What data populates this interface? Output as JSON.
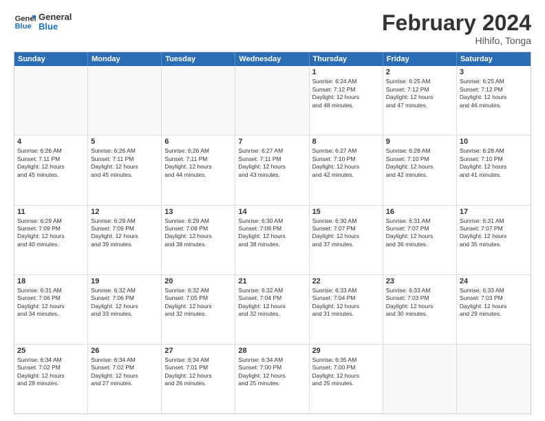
{
  "header": {
    "logo_line1": "General",
    "logo_line2": "Blue",
    "month": "February 2024",
    "location": "Hihifo, Tonga"
  },
  "days_of_week": [
    "Sunday",
    "Monday",
    "Tuesday",
    "Wednesday",
    "Thursday",
    "Friday",
    "Saturday"
  ],
  "weeks": [
    [
      {
        "day": "",
        "info": ""
      },
      {
        "day": "",
        "info": ""
      },
      {
        "day": "",
        "info": ""
      },
      {
        "day": "",
        "info": ""
      },
      {
        "day": "1",
        "info": "Sunrise: 6:24 AM\nSunset: 7:12 PM\nDaylight: 12 hours\nand 48 minutes."
      },
      {
        "day": "2",
        "info": "Sunrise: 6:25 AM\nSunset: 7:12 PM\nDaylight: 12 hours\nand 47 minutes."
      },
      {
        "day": "3",
        "info": "Sunrise: 6:25 AM\nSunset: 7:12 PM\nDaylight: 12 hours\nand 46 minutes."
      }
    ],
    [
      {
        "day": "4",
        "info": "Sunrise: 6:26 AM\nSunset: 7:11 PM\nDaylight: 12 hours\nand 45 minutes."
      },
      {
        "day": "5",
        "info": "Sunrise: 6:26 AM\nSunset: 7:11 PM\nDaylight: 12 hours\nand 45 minutes."
      },
      {
        "day": "6",
        "info": "Sunrise: 6:26 AM\nSunset: 7:11 PM\nDaylight: 12 hours\nand 44 minutes."
      },
      {
        "day": "7",
        "info": "Sunrise: 6:27 AM\nSunset: 7:11 PM\nDaylight: 12 hours\nand 43 minutes."
      },
      {
        "day": "8",
        "info": "Sunrise: 6:27 AM\nSunset: 7:10 PM\nDaylight: 12 hours\nand 42 minutes."
      },
      {
        "day": "9",
        "info": "Sunrise: 6:28 AM\nSunset: 7:10 PM\nDaylight: 12 hours\nand 42 minutes."
      },
      {
        "day": "10",
        "info": "Sunrise: 6:28 AM\nSunset: 7:10 PM\nDaylight: 12 hours\nand 41 minutes."
      }
    ],
    [
      {
        "day": "11",
        "info": "Sunrise: 6:29 AM\nSunset: 7:09 PM\nDaylight: 12 hours\nand 40 minutes."
      },
      {
        "day": "12",
        "info": "Sunrise: 6:29 AM\nSunset: 7:09 PM\nDaylight: 12 hours\nand 39 minutes."
      },
      {
        "day": "13",
        "info": "Sunrise: 6:29 AM\nSunset: 7:08 PM\nDaylight: 12 hours\nand 38 minutes."
      },
      {
        "day": "14",
        "info": "Sunrise: 6:30 AM\nSunset: 7:08 PM\nDaylight: 12 hours\nand 38 minutes."
      },
      {
        "day": "15",
        "info": "Sunrise: 6:30 AM\nSunset: 7:07 PM\nDaylight: 12 hours\nand 37 minutes."
      },
      {
        "day": "16",
        "info": "Sunrise: 6:31 AM\nSunset: 7:07 PM\nDaylight: 12 hours\nand 36 minutes."
      },
      {
        "day": "17",
        "info": "Sunrise: 6:31 AM\nSunset: 7:07 PM\nDaylight: 12 hours\nand 35 minutes."
      }
    ],
    [
      {
        "day": "18",
        "info": "Sunrise: 6:31 AM\nSunset: 7:06 PM\nDaylight: 12 hours\nand 34 minutes."
      },
      {
        "day": "19",
        "info": "Sunrise: 6:32 AM\nSunset: 7:06 PM\nDaylight: 12 hours\nand 33 minutes."
      },
      {
        "day": "20",
        "info": "Sunrise: 6:32 AM\nSunset: 7:05 PM\nDaylight: 12 hours\nand 32 minutes."
      },
      {
        "day": "21",
        "info": "Sunrise: 6:32 AM\nSunset: 7:04 PM\nDaylight: 12 hours\nand 32 minutes."
      },
      {
        "day": "22",
        "info": "Sunrise: 6:33 AM\nSunset: 7:04 PM\nDaylight: 12 hours\nand 31 minutes."
      },
      {
        "day": "23",
        "info": "Sunrise: 6:33 AM\nSunset: 7:03 PM\nDaylight: 12 hours\nand 30 minutes."
      },
      {
        "day": "24",
        "info": "Sunrise: 6:33 AM\nSunset: 7:03 PM\nDaylight: 12 hours\nand 29 minutes."
      }
    ],
    [
      {
        "day": "25",
        "info": "Sunrise: 6:34 AM\nSunset: 7:02 PM\nDaylight: 12 hours\nand 28 minutes."
      },
      {
        "day": "26",
        "info": "Sunrise: 6:34 AM\nSunset: 7:02 PM\nDaylight: 12 hours\nand 27 minutes."
      },
      {
        "day": "27",
        "info": "Sunrise: 6:34 AM\nSunset: 7:01 PM\nDaylight: 12 hours\nand 26 minutes."
      },
      {
        "day": "28",
        "info": "Sunrise: 6:34 AM\nSunset: 7:00 PM\nDaylight: 12 hours\nand 25 minutes."
      },
      {
        "day": "29",
        "info": "Sunrise: 6:35 AM\nSunset: 7:00 PM\nDaylight: 12 hours\nand 25 minutes."
      },
      {
        "day": "",
        "info": ""
      },
      {
        "day": "",
        "info": ""
      }
    ]
  ]
}
